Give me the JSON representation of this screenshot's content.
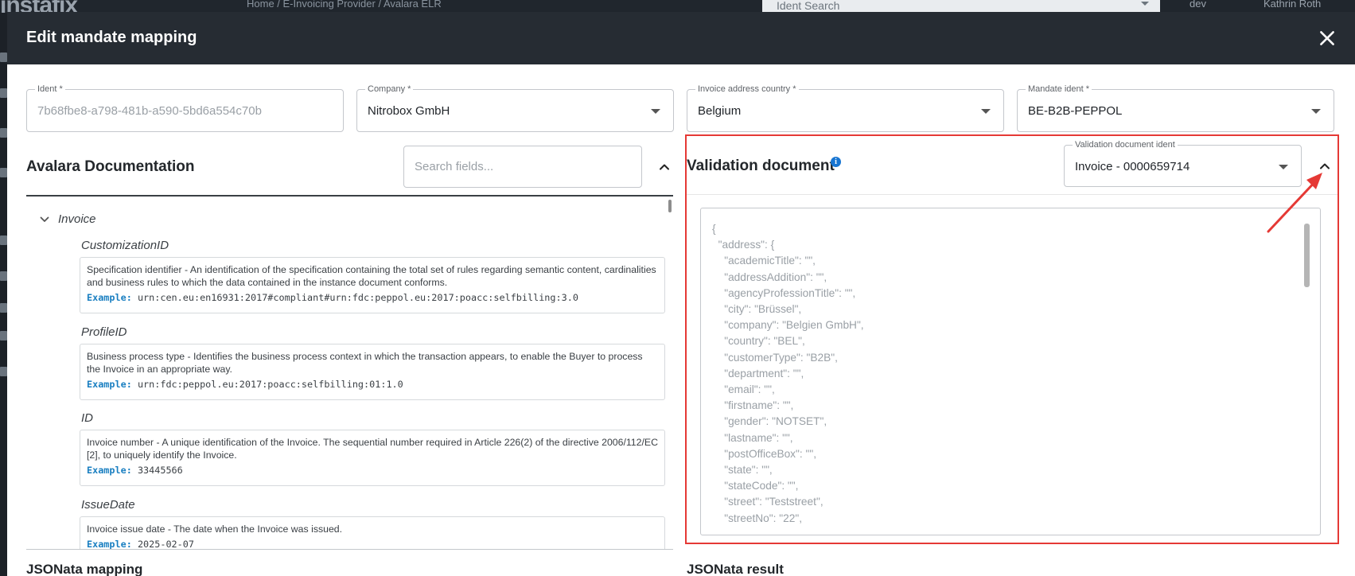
{
  "background": {
    "logo": "instafix",
    "breadcrumb": "Home  /  E-Invoicing Provider  /  Avalara ELR",
    "search_placeholder": "Ident Search",
    "env": "dev",
    "user": "Kathrin Roth"
  },
  "modal": {
    "title": "Edit mandate mapping"
  },
  "fields": {
    "ident": {
      "label": "Ident *",
      "value": "7b68fbe8-a798-481b-a590-5bd6a554c70b"
    },
    "company": {
      "label": "Company *",
      "value": "Nitrobox GmbH"
    },
    "country": {
      "label": "Invoice address country *",
      "value": "Belgium"
    },
    "mandate": {
      "label": "Mandate ident *",
      "value": "BE-B2B-PEPPOL"
    }
  },
  "documentation": {
    "title": "Avalara Documentation",
    "search_placeholder": "Search fields...",
    "group": "Invoice",
    "example_label": "Example:",
    "items": [
      {
        "name": "CustomizationID",
        "description": "Specification identifier - An identification of the specification containing the total set of rules regarding semantic content, cardinalities and business rules to which the data contained in the instance document conforms.",
        "example": "urn:cen.eu:en16931:2017#compliant#urn:fdc:peppol.eu:2017:poacc:selfbilling:3.0"
      },
      {
        "name": "ProfileID",
        "description": "Business process type - Identifies the business process context in which the transaction appears, to enable the Buyer to process the Invoice in an appropriate way.",
        "example": "urn:fdc:peppol.eu:2017:poacc:selfbilling:01:1.0"
      },
      {
        "name": "ID",
        "description": "Invoice number - A unique identification of the Invoice. The sequential number required in Article 226(2) of the directive 2006/112/EC [2], to uniquely identify the Invoice.",
        "example": "33445566"
      },
      {
        "name": "IssueDate",
        "description": "Invoice issue date - The date when the Invoice was issued.",
        "example": "2025-02-07"
      }
    ]
  },
  "validation": {
    "title": "Validation document",
    "info_icon": "i",
    "select_label": "Validation document ident",
    "select_value": "Invoice - 0000659714",
    "json": "{\n  \"address\": {\n    \"academicTitle\": \"\",\n    \"addressAddition\": \"\",\n    \"agencyProfessionTitle\": \"\",\n    \"city\": \"Brüssel\",\n    \"company\": \"Belgien GmbH\",\n    \"country\": \"BEL\",\n    \"customerType\": \"B2B\",\n    \"department\": \"\",\n    \"email\": \"\",\n    \"firstname\": \"\",\n    \"gender\": \"NOTSET\",\n    \"lastname\": \"\",\n    \"postOfficeBox\": \"\",\n    \"state\": \"\",\n    \"stateCode\": \"\",\n    \"street\": \"Teststreet\",\n    \"streetNo\": \"22\","
  },
  "bottom": {
    "mapping_title": "JSONata mapping",
    "result_title": "JSONata result"
  },
  "colors": {
    "header_bg": "#262c33",
    "highlight": "#e53935",
    "example_label": "#1a7fc1",
    "info": "#1976d2"
  }
}
